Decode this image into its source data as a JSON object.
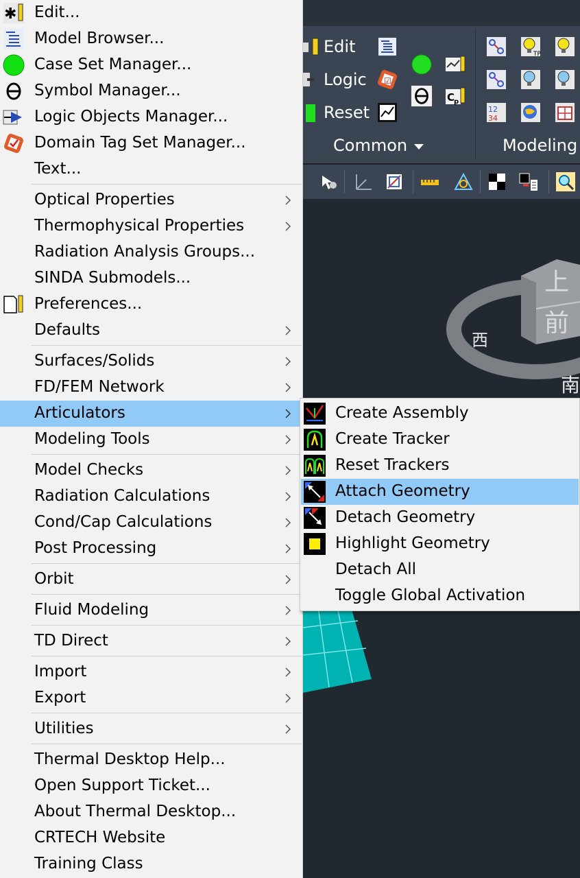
{
  "ribbon": {
    "row1": "Edit",
    "row2": "Logic",
    "row3": "Reset",
    "common_label": "Common",
    "modeling_label": "Modeling"
  },
  "viewcube": {
    "top": "上",
    "front": "前",
    "west": "西",
    "south": "南"
  },
  "main_menu": [
    {
      "label": "Edit...",
      "icon": "edit-icon"
    },
    {
      "label": "Model Browser...",
      "icon": "model-browser-icon"
    },
    {
      "label": "Case Set Manager...",
      "icon": "green-circle-icon"
    },
    {
      "label": "Symbol Manager...",
      "icon": "symbol-theta-icon"
    },
    {
      "label": "Logic Objects Manager...",
      "icon": "logic-objects-icon"
    },
    {
      "label": "Domain Tag Set Manager...",
      "icon": "domain-tag-icon"
    },
    {
      "label": "Text..."
    },
    {
      "label": "Optical Properties",
      "submenu": true
    },
    {
      "label": "Thermophysical Properties",
      "submenu": true
    },
    {
      "label": "Radiation Analysis Groups..."
    },
    {
      "label": "SINDA Submodels..."
    },
    {
      "label": "Preferences...",
      "icon": "preferences-icon"
    },
    {
      "label": "Defaults",
      "submenu": true
    },
    {
      "label": "Surfaces/Solids",
      "submenu": true
    },
    {
      "label": "FD/FEM Network",
      "submenu": true
    },
    {
      "label": "Articulators",
      "submenu": true,
      "highlighted": true
    },
    {
      "label": "Modeling Tools",
      "submenu": true
    },
    {
      "label": "Model Checks",
      "submenu": true
    },
    {
      "label": "Radiation Calculations",
      "submenu": true
    },
    {
      "label": "Cond/Cap Calculations",
      "submenu": true
    },
    {
      "label": "Post Processing",
      "submenu": true
    },
    {
      "label": "Orbit",
      "submenu": true
    },
    {
      "label": "Fluid Modeling",
      "submenu": true
    },
    {
      "label": "TD Direct",
      "submenu": true
    },
    {
      "label": "Import",
      "submenu": true
    },
    {
      "label": "Export",
      "submenu": true
    },
    {
      "label": "Utilities",
      "submenu": true
    },
    {
      "label": "Thermal Desktop Help..."
    },
    {
      "label": "Open Support Ticket..."
    },
    {
      "label": "About Thermal Desktop..."
    },
    {
      "label": "CRTECH Website"
    },
    {
      "label": "Training Class"
    }
  ],
  "articulators_submenu": [
    {
      "label": "Create Assembly",
      "icon": "create-assembly-icon"
    },
    {
      "label": "Create Tracker",
      "icon": "create-tracker-icon"
    },
    {
      "label": "Reset Trackers",
      "icon": "reset-trackers-icon"
    },
    {
      "label": "Attach Geometry",
      "icon": "attach-geometry-icon",
      "highlighted": true
    },
    {
      "label": "Detach Geometry",
      "icon": "detach-geometry-icon"
    },
    {
      "label": "Highlight Geometry",
      "icon": "highlight-geometry-icon"
    },
    {
      "label": "Detach All"
    },
    {
      "label": "Toggle Global Activation"
    }
  ],
  "colors": {
    "highlight": "#91c9f7",
    "menu_bg": "#f2f2f2",
    "ribbon_bg": "#3b4453",
    "viewport_bg": "#212830",
    "mesh": "#00b3b3"
  }
}
